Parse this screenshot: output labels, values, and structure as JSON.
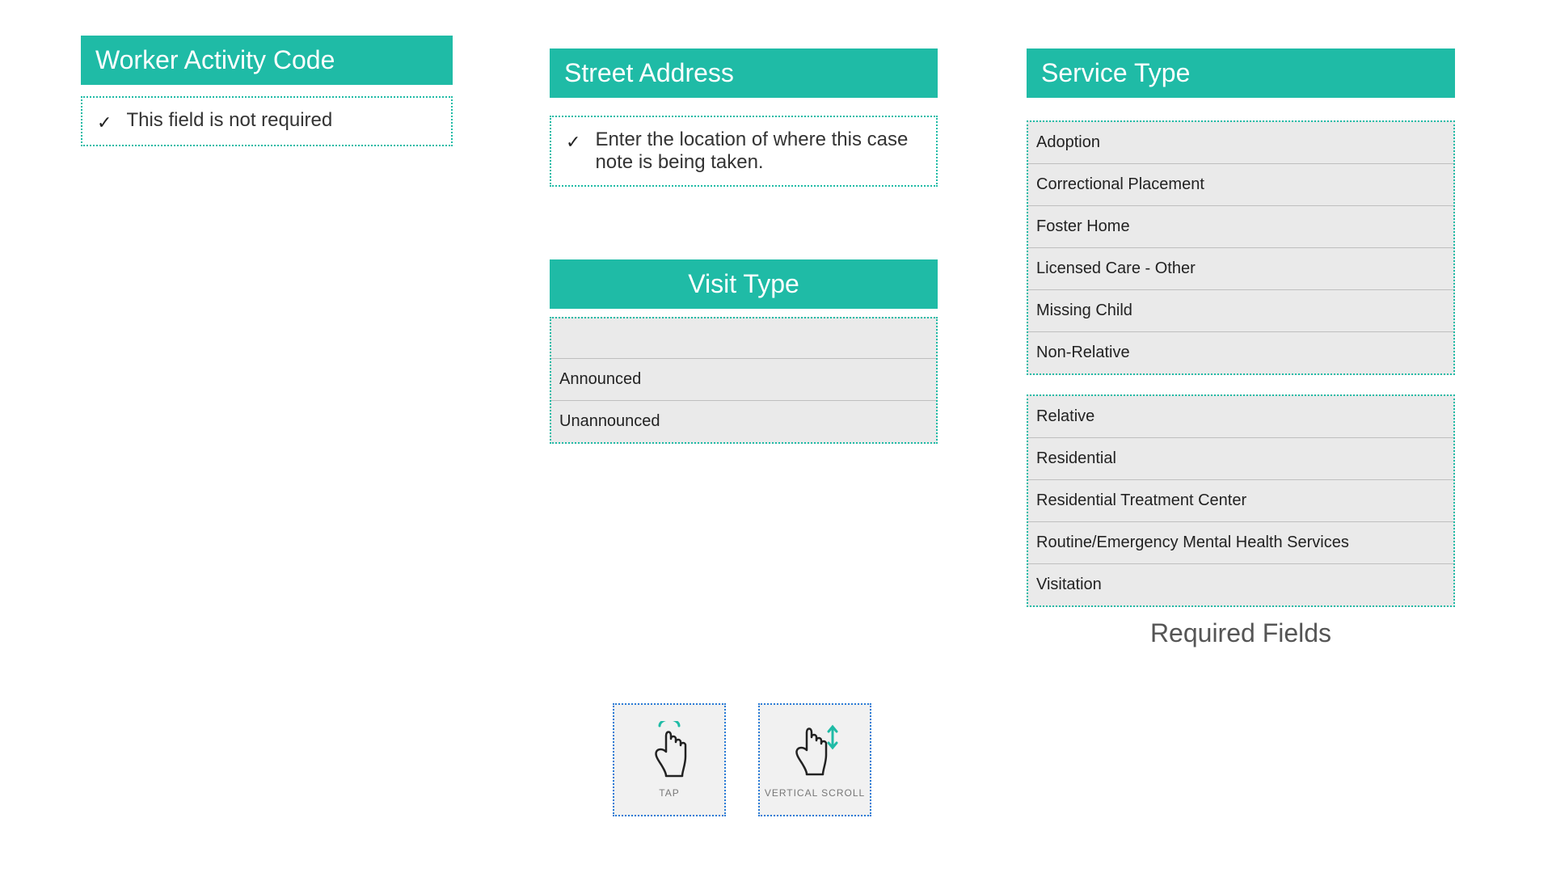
{
  "worker_activity": {
    "title": "Worker Activity Code",
    "note": "This field is not required"
  },
  "street_address": {
    "title": "Street Address",
    "note": "Enter the location of where this case note is being taken."
  },
  "visit_type": {
    "title": "Visit Type",
    "options": [
      "",
      "Announced",
      "Unannounced"
    ]
  },
  "service_type": {
    "title": "Service Type",
    "group1": [
      "Adoption",
      "Correctional Placement",
      "Foster Home",
      "Licensed Care - Other",
      "Missing Child",
      "Non-Relative"
    ],
    "group2": [
      "Relative",
      "Residential",
      "Residential Treatment Center",
      "Routine/Emergency Mental Health Services",
      "Visitation"
    ]
  },
  "gestures": {
    "tap": "TAP",
    "scroll": "VERTICAL SCROLL"
  },
  "required_label": "Required Fields"
}
